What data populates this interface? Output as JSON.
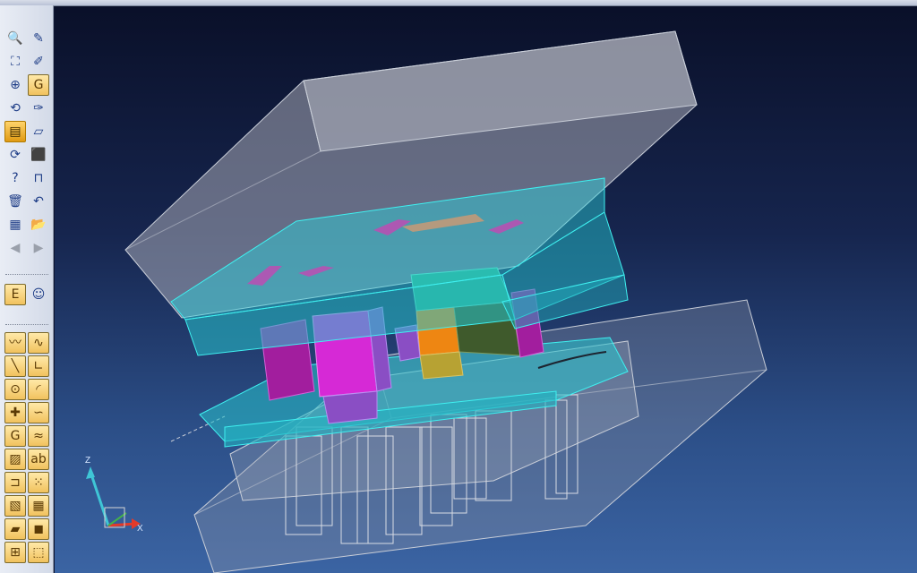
{
  "app": {
    "title": ""
  },
  "toolbar": {
    "groups": [
      {
        "name": "view",
        "items": [
          {
            "icon": "zoom-icon",
            "glyph": "🔍",
            "style": "plain"
          },
          {
            "icon": "sketch-icon",
            "glyph": "✎",
            "style": "plain"
          },
          {
            "icon": "fit-all-icon",
            "glyph": "⛶",
            "style": "plain"
          },
          {
            "icon": "pencil-icon",
            "glyph": "✐",
            "style": "plain"
          },
          {
            "icon": "zoom-area-icon",
            "glyph": "⊕",
            "style": "plain"
          },
          {
            "icon": "label-g-icon",
            "glyph": "G",
            "style": "boxed"
          },
          {
            "icon": "rotate-icon",
            "glyph": "⟲",
            "style": "plain"
          },
          {
            "icon": "brush-icon",
            "glyph": "✑",
            "style": "plain"
          },
          {
            "icon": "spec-tree-icon",
            "glyph": "▤",
            "style": "active"
          },
          {
            "icon": "plane-icon",
            "glyph": "▱",
            "style": "plain"
          },
          {
            "icon": "refresh-icon",
            "glyph": "⟳",
            "style": "plain"
          },
          {
            "icon": "cube-icon",
            "glyph": "⬛",
            "style": "plain"
          },
          {
            "icon": "help-icon",
            "glyph": "?",
            "style": "plain"
          },
          {
            "icon": "dimension-icon",
            "glyph": "⊓",
            "style": "plain"
          },
          {
            "icon": "trash-icon",
            "glyph": "🗑",
            "style": "plain"
          },
          {
            "icon": "undo-icon",
            "glyph": "↶",
            "style": "plain"
          },
          {
            "icon": "assembly-icon",
            "glyph": "▦",
            "style": "plain"
          },
          {
            "icon": "open-folder-icon",
            "glyph": "📂",
            "style": "plain"
          },
          {
            "icon": "arrow-left-icon",
            "glyph": "◀",
            "style": "disabled"
          },
          {
            "icon": "arrow-right-icon",
            "glyph": "▶",
            "style": "disabled"
          }
        ]
      },
      {
        "name": "misc",
        "items": [
          {
            "icon": "label-e-icon",
            "glyph": "E",
            "style": "boxed"
          },
          {
            "icon": "smiley-icon",
            "glyph": "☺",
            "style": "plain"
          }
        ]
      },
      {
        "name": "sketch-tools",
        "items": [
          {
            "icon": "polyline-icon",
            "glyph": "〰",
            "style": "boxed"
          },
          {
            "icon": "spline-icon",
            "glyph": "∿",
            "style": "boxed"
          },
          {
            "icon": "line-icon",
            "glyph": "╲",
            "style": "boxed"
          },
          {
            "icon": "corner-icon",
            "glyph": "∟",
            "style": "boxed"
          },
          {
            "icon": "circle-icon",
            "glyph": "⊙",
            "style": "boxed"
          },
          {
            "icon": "arc-icon",
            "glyph": "◜",
            "style": "boxed"
          },
          {
            "icon": "point-icon",
            "glyph": "✚",
            "style": "boxed"
          },
          {
            "icon": "curve-icon",
            "glyph": "∽",
            "style": "boxed"
          },
          {
            "icon": "label-g-icon",
            "glyph": "G",
            "style": "boxed"
          },
          {
            "icon": "wave-icon",
            "glyph": "≈",
            "style": "boxed"
          },
          {
            "icon": "hatch-icon",
            "glyph": "▨",
            "style": "boxed"
          },
          {
            "icon": "abc-text-icon",
            "glyph": "ab",
            "style": "boxed"
          },
          {
            "icon": "bracket-icon",
            "glyph": "⊐",
            "style": "boxed"
          },
          {
            "icon": "dot-grid-icon",
            "glyph": "⁙",
            "style": "boxed"
          },
          {
            "icon": "diagonal-hatch-icon",
            "glyph": "▧",
            "style": "boxed"
          },
          {
            "icon": "grid-icon",
            "glyph": "▦",
            "style": "boxed"
          },
          {
            "icon": "surface-icon",
            "glyph": "▰",
            "style": "boxed"
          },
          {
            "icon": "solid-cube-icon",
            "glyph": "◼",
            "style": "boxed"
          },
          {
            "icon": "measure-icon",
            "glyph": "⊞",
            "style": "boxed"
          },
          {
            "icon": "cube-color-icon",
            "glyph": "⬚",
            "style": "boxed"
          }
        ]
      }
    ]
  },
  "axis": {
    "z_label": "Z",
    "x_label": "X",
    "z_color": "#3fc6d6",
    "x_color": "#e23a2a",
    "y_color": "#43b24a"
  },
  "colors": {
    "glass_line": "#c9ced8",
    "cyan": "#3ff0f0",
    "magenta": "#d629d6",
    "orange": "#ee8612",
    "green": "#2aa88a",
    "dark_green": "#3f5a2c",
    "purple": "#8a4ec4"
  }
}
